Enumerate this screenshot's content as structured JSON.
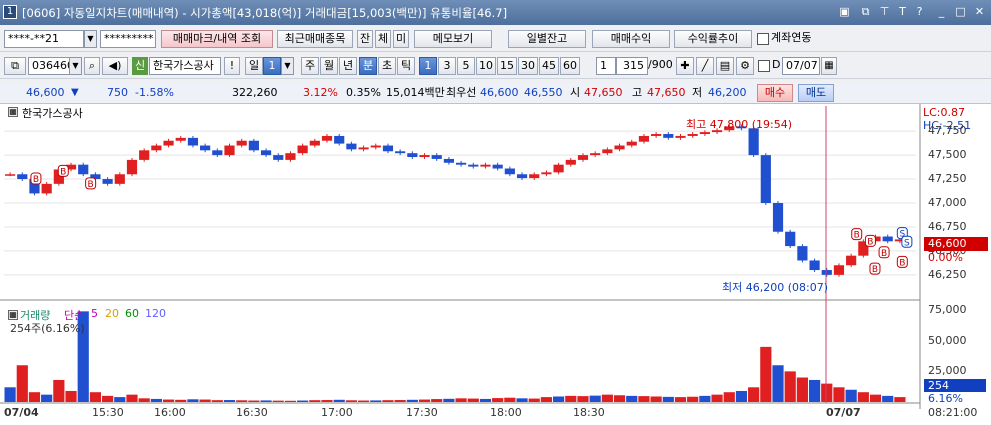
{
  "title_bar": {
    "window_number": "1",
    "title": "[0606] 자동일지차트(매매내역) - 시가총액[43,018(억)] 거래대금[15,003(백만)] 유통비율[46.7]",
    "controls": [
      "window-icon",
      "restore-icon",
      "pin-icon",
      "font-icon",
      "help-icon",
      "minimize-icon",
      "maximize-icon",
      "close-icon"
    ]
  },
  "toolbar1": {
    "account_value": "****-**21",
    "password_value": "*********",
    "buttons": [
      "매매마크/내역 조회",
      "최근매매종목",
      "잔",
      "체",
      "미",
      "메모보기",
      "일별잔고",
      "매매수익",
      "수익률추이"
    ],
    "link_label": "계좌연동"
  },
  "toolbar2": {
    "stock_code": "036460",
    "stock_badge": "신",
    "stock_name": "한국가스공사",
    "warn_label": "!",
    "period_labels": [
      "일",
      "1",
      "주",
      "월",
      "년",
      "분",
      "초",
      "틱"
    ],
    "selected_period": "분",
    "interval_buttons": [
      "1",
      "3",
      "5",
      "10",
      "15",
      "30",
      "45",
      "60"
    ],
    "selected_interval": "1",
    "interval_combo": "1",
    "count_value": "315",
    "count_max": "/900",
    "date_check_label": "D",
    "date_value": "07/07"
  },
  "quote_bar": {
    "price": "46,600",
    "change_sign": "▼",
    "change": "750",
    "change_pct": "-1.58%",
    "volume": "322,260",
    "volume_pct": "3.12%",
    "turnover_pct": "0.35%",
    "amount": "15,014백만",
    "best_label": "최우선",
    "best_ask": "46,600",
    "best_bid": "46,550",
    "open_label": "시",
    "open": "47,650",
    "high_label": "고",
    "high": "47,650",
    "low_label": "저",
    "low": "46,200",
    "buy_label": "매수",
    "sell_label": "매도"
  },
  "chart_data": [
    {
      "type": "candlestick",
      "stock_label": "한국가스공사",
      "ylim": [
        46050,
        47950
      ],
      "y_ticks": [
        "47,750",
        "47,500",
        "47,250",
        "47,000",
        "46,750",
        "46,500",
        "46,250"
      ],
      "lc_label": "LC:0.87",
      "hc_label": "HC:-2.51",
      "current_price_label": "46,600",
      "current_pct_label": "0.00%",
      "annotations": {
        "high": "최고 47,800 (19:54)",
        "low": "최저 46,200 (08:07)"
      },
      "trade_marks": [
        {
          "type": "B",
          "x": 0.035,
          "y": 47250
        },
        {
          "type": "B",
          "x": 0.065,
          "y": 47330
        },
        {
          "type": "B",
          "x": 0.095,
          "y": 47200
        },
        {
          "type": "B",
          "x": 0.935,
          "y": 46670
        },
        {
          "type": "B",
          "x": 0.95,
          "y": 46600
        },
        {
          "type": "B",
          "x": 0.965,
          "y": 46480
        },
        {
          "type": "B",
          "x": 0.985,
          "y": 46380
        },
        {
          "type": "B",
          "x": 0.955,
          "y": 46310
        },
        {
          "type": "S",
          "x": 0.985,
          "y": 46680
        },
        {
          "type": "S",
          "x": 0.99,
          "y": 46590
        }
      ],
      "x_labels": [
        "07/04",
        "15:30",
        "16:00",
        "16:30",
        "17:00",
        "17:30",
        "18:00",
        "18:30",
        "07/07",
        "08:21:00"
      ],
      "series": [
        {
          "name": "price",
          "values": [
            47300,
            47250,
            47100,
            47200,
            47350,
            47400,
            47300,
            47250,
            47200,
            47300,
            47450,
            47550,
            47600,
            47650,
            47680,
            47600,
            47550,
            47500,
            47600,
            47650,
            47550,
            47500,
            47450,
            47520,
            47600,
            47650,
            47700,
            47620,
            47560,
            47580,
            47600,
            47540,
            47520,
            47480,
            47500,
            47460,
            47420,
            47400,
            47380,
            47400,
            47360,
            47300,
            47260,
            47300,
            47320,
            47400,
            47450,
            47500,
            47520,
            47560,
            47600,
            47640,
            47700,
            47720,
            47680,
            47700,
            47720,
            47740,
            47760,
            47800,
            47780,
            47500,
            47000,
            46700,
            46550,
            46400,
            46300,
            46250,
            46350,
            46450,
            46600,
            46650,
            46600,
            46620
          ]
        }
      ]
    },
    {
      "type": "bar",
      "panel_label": "거래량",
      "ma_labels": [
        "단순",
        "5",
        "20",
        "60",
        "120"
      ],
      "ma_colors": [
        "#c000c0",
        "#d4a000",
        "#009000",
        "#6060ff"
      ],
      "volume_label": "254주(6.16%)",
      "ylim": [
        0,
        80000
      ],
      "y_ticks": [
        "75,000",
        "50,000",
        "25,000"
      ],
      "current_volume_label": "254",
      "current_volume_pct": "6.16%",
      "values": [
        12000,
        30000,
        8000,
        6000,
        18000,
        9000,
        74000,
        8000,
        5000,
        4000,
        6000,
        3000,
        2500,
        2000,
        1800,
        2200,
        2000,
        1500,
        1600,
        1400,
        1200,
        1300,
        1100,
        1000,
        1200,
        1500,
        1600,
        1800,
        1400,
        1200,
        1300,
        1500,
        1600,
        1800,
        2000,
        2400,
        2600,
        3000,
        2800,
        2500,
        3200,
        3500,
        3000,
        2800,
        4000,
        4500,
        5000,
        4800,
        5200,
        6000,
        5500,
        5000,
        4800,
        4500,
        4200,
        4000,
        4300,
        5000,
        6000,
        8000,
        9000,
        12000,
        45000,
        30000,
        25000,
        20000,
        18000,
        15000,
        12000,
        10000,
        8000,
        6000,
        5000,
        4000
      ]
    }
  ]
}
